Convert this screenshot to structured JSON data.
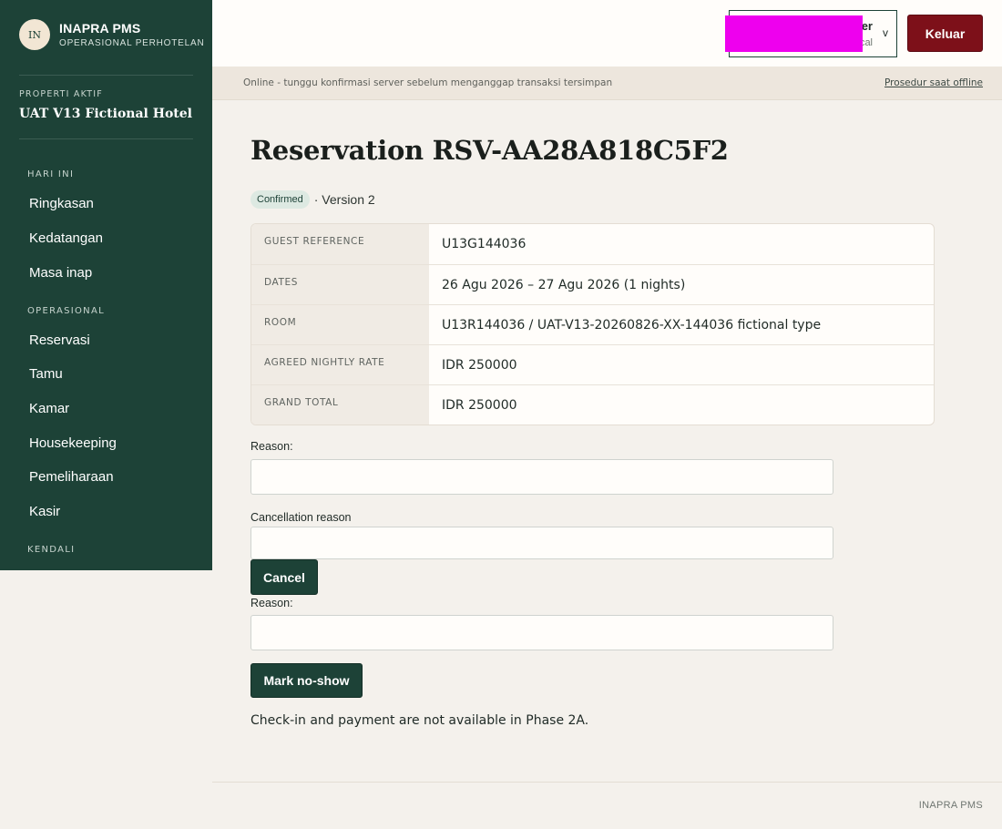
{
  "brand": {
    "logo_text": "IN",
    "name": "INAPRA PMS",
    "subtitle": "OPERASIONAL PERHOTELAN"
  },
  "property": {
    "label": "PROPERTI AKTIF",
    "name": "UAT V13 Fictional Hotel"
  },
  "nav": {
    "section_today": "HARI INI",
    "ringkasan": "Ringkasan",
    "kedatangan": "Kedatangan",
    "masa_inap": "Masa inap",
    "section_ops": "OPERASIONAL",
    "reservasi": "Reservasi",
    "tamu": "Tamu",
    "kamar": "Kamar",
    "housekeeping": "Housekeeping",
    "pemeliharaan": "Pemeliharaan",
    "kasir": "Kasir",
    "section_control": "KENDALI"
  },
  "user": {
    "name_visible": "er",
    "location_visible": "cal",
    "chevron": "v",
    "redact_color": "#ee00ee"
  },
  "logout_label": "Keluar",
  "status": {
    "text": "Online - tunggu konfirmasi server sebelum menganggap transaksi tersimpan",
    "link": "Prosedur saat offline"
  },
  "reservation": {
    "title": "Reservation RSV-AA28A818C5F2",
    "badge": "Confirmed",
    "version": "· Version 2",
    "details": {
      "guest_ref_label": "GUEST REFERENCE",
      "guest_ref_value": "U13G144036",
      "dates_label": "DATES",
      "dates_value": "26 Agu 2026 – 27 Agu 2026 (1 nights)",
      "room_label": "ROOM",
      "room_value": "U13R144036 / UAT-V13-20260826-XX-144036 fictional type",
      "rate_label": "AGREED NIGHTLY RATE",
      "rate_value": "IDR 250000",
      "total_label": "GRAND TOTAL",
      "total_value": "IDR 250000"
    }
  },
  "forms": {
    "reason_label_1": "Reason:",
    "reason_value_1": "",
    "cancel_reason_label": "Cancellation reason",
    "cancel_reason_value": "",
    "cancel_button": "Cancel",
    "reason_label_2": "Reason:",
    "reason_value_2": "",
    "noshow_button": "Mark no-show"
  },
  "note": "Check-in and payment are not available in Phase 2A.",
  "footer": "INAPRA PMS",
  "colors": {
    "sidebar": "#1d4237",
    "logout": "#7d1019",
    "primary": "#1d4237",
    "background": "#f4f1ec"
  }
}
